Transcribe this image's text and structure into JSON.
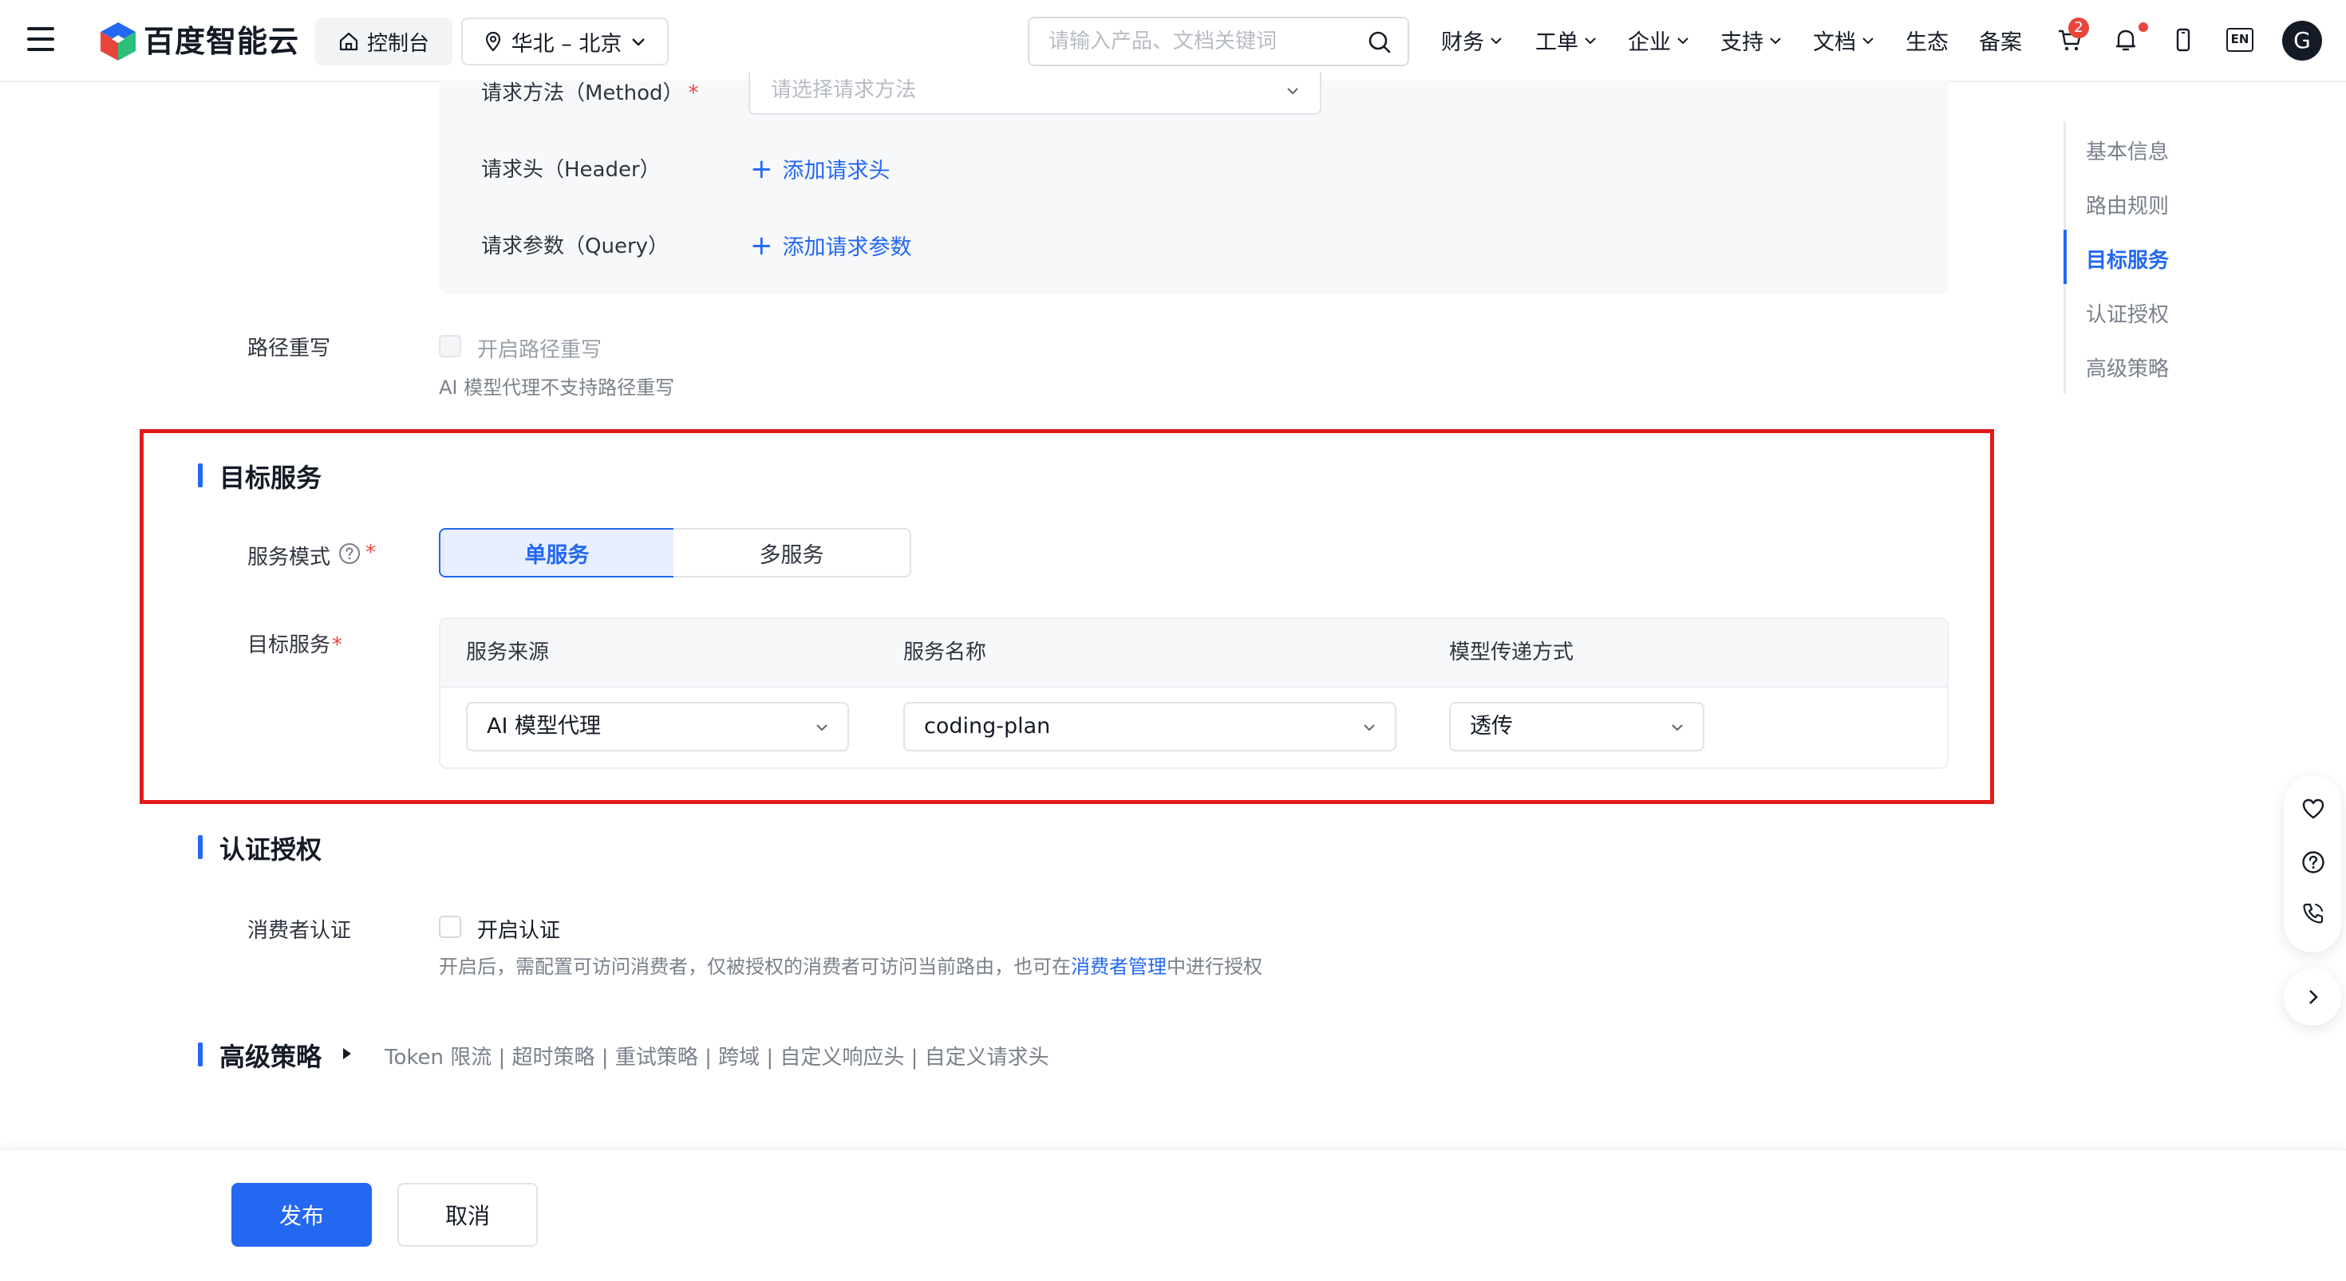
{
  "header": {
    "brand": "百度智能云",
    "console_label": "控制台",
    "region_label": "华北 – 北京",
    "search_placeholder": "请输入产品、文档关键词",
    "nav": [
      {
        "label": "财务",
        "dropdown": true
      },
      {
        "label": "工单",
        "dropdown": true
      },
      {
        "label": "企业",
        "dropdown": true
      },
      {
        "label": "支持",
        "dropdown": true
      },
      {
        "label": "文档",
        "dropdown": true
      },
      {
        "label": "生态",
        "dropdown": false
      },
      {
        "label": "备案",
        "dropdown": false
      }
    ],
    "cart_badge": "2",
    "lang_label": "EN",
    "avatar_letter": "G"
  },
  "request_match": {
    "method_label": "请求方法（Method）",
    "method_placeholder": "请选择请求方法",
    "header_label": "请求头（Header）",
    "header_add": "添加请求头",
    "query_label": "请求参数（Query）",
    "query_add": "添加请求参数"
  },
  "path_rewrite": {
    "label": "路径重写",
    "checkbox_label": "开启路径重写",
    "hint": "AI 模型代理不支持路径重写"
  },
  "target_service": {
    "title": "目标服务",
    "mode_label": "服务模式",
    "mode_options": [
      "单服务",
      "多服务"
    ],
    "mode_selected": "单服务",
    "service_label": "目标服务",
    "columns": [
      "服务来源",
      "服务名称",
      "模型传递方式"
    ],
    "row": {
      "source": "AI 模型代理",
      "name": "coding-plan",
      "passing": "透传"
    }
  },
  "auth": {
    "title": "认证授权",
    "consumer_label": "消费者认证",
    "checkbox_label": "开启认证",
    "hint_before": "开启后，需配置可访问消费者，仅被授权的消费者可访问当前路由，也可在",
    "hint_link": "消费者管理",
    "hint_after": "中进行授权"
  },
  "advanced": {
    "title": "高级策略",
    "summary": "Token 限流 | 超时策略 | 重试策略 | 跨域 | 自定义响应头 | 自定义请求头"
  },
  "footer": {
    "publish": "发布",
    "cancel": "取消"
  },
  "anchor_nav": {
    "items": [
      "基本信息",
      "路由规则",
      "目标服务",
      "认证授权",
      "高级策略"
    ],
    "active": "目标服务"
  },
  "colors": {
    "primary": "#2468f2",
    "required": "#e8453c",
    "highlight_box": "#e01b1b"
  }
}
